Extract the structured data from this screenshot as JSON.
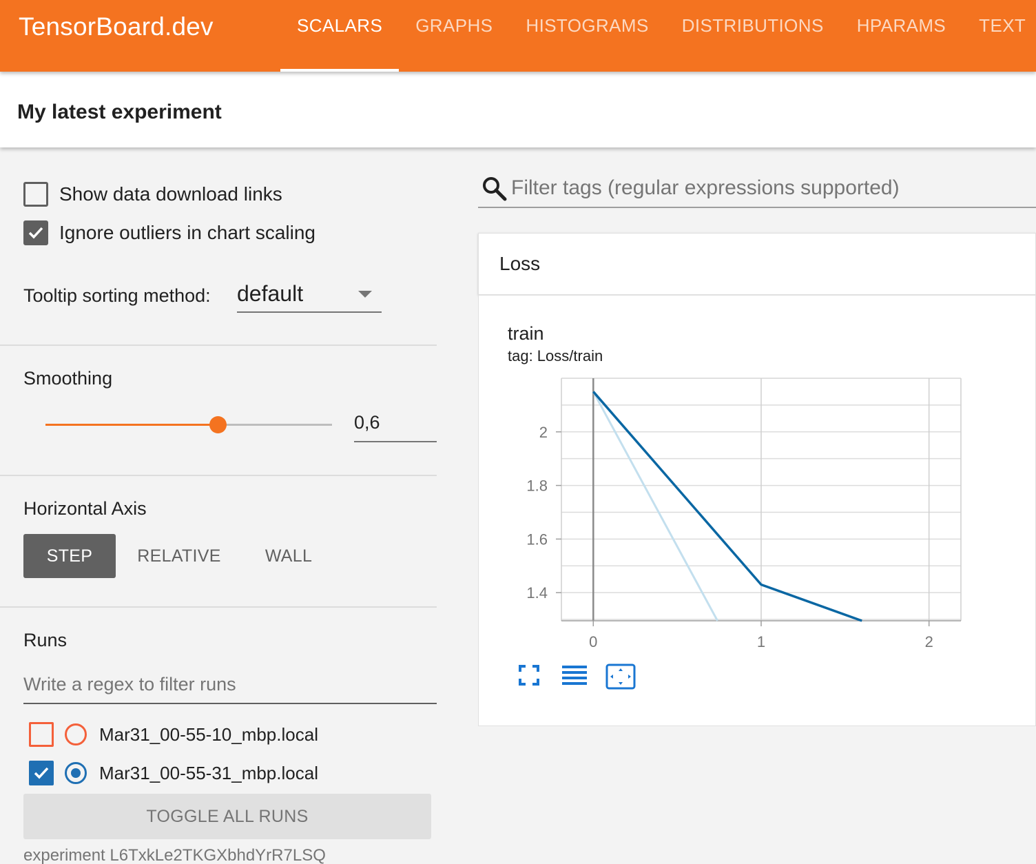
{
  "app": {
    "brand": "TensorBoard.dev",
    "tabs": [
      {
        "label": "SCALARS",
        "active": true
      },
      {
        "label": "GRAPHS",
        "active": false
      },
      {
        "label": "HISTOGRAMS",
        "active": false
      },
      {
        "label": "DISTRIBUTIONS",
        "active": false
      },
      {
        "label": "HPARAMS",
        "active": false
      },
      {
        "label": "TEXT",
        "active": false
      }
    ]
  },
  "experiment": {
    "title": "My latest experiment",
    "id_text": "experiment L6TxkLe2TKGXbhdYrR7LSQ"
  },
  "sidebar": {
    "show_download_links": {
      "label": "Show data download links",
      "checked": false
    },
    "ignore_outliers": {
      "label": "Ignore outliers in chart scaling",
      "checked": true
    },
    "tooltip_sorting": {
      "label": "Tooltip sorting method:",
      "value": "default"
    },
    "smoothing": {
      "title": "Smoothing",
      "value": 0.6,
      "display": "0,6"
    },
    "horizontal_axis": {
      "title": "Horizontal Axis",
      "options": [
        {
          "label": "STEP",
          "active": true
        },
        {
          "label": "RELATIVE",
          "active": false
        },
        {
          "label": "WALL",
          "active": false
        }
      ]
    },
    "runs": {
      "title": "Runs",
      "filter_placeholder": "Write a regex to filter runs",
      "items": [
        {
          "name": "Mar31_00-55-10_mbp.local",
          "checked": false,
          "selected": false,
          "color": "#f4603a"
        },
        {
          "name": "Mar31_00-55-31_mbp.local",
          "checked": true,
          "selected": true,
          "color": "#1f6fb3"
        }
      ],
      "toggle_all_label": "TOGGLE ALL RUNS"
    }
  },
  "main": {
    "tag_filter_placeholder": "Filter tags (regular expressions supported)",
    "card": {
      "title": "Loss",
      "chart_title": "train",
      "chart_tag": "tag: Loss/train"
    }
  },
  "chart_data": {
    "type": "line",
    "title": "train",
    "subtitle": "tag: Loss/train",
    "xlabel": "",
    "ylabel": "",
    "x_ticks": [
      0,
      1,
      2
    ],
    "y_ticks": [
      1.4,
      1.6,
      1.8,
      2
    ],
    "xlim": [
      -0.19,
      2.19
    ],
    "ylim": [
      1.295,
      2.2
    ],
    "grid": true,
    "series": [
      {
        "role": "smoothed",
        "color": "#0a67a3",
        "x": [
          0,
          1,
          1.6
        ],
        "y": [
          2.15,
          1.43,
          1.295
        ]
      },
      {
        "role": "raw",
        "color": "#c3dfee",
        "x": [
          0,
          0.74
        ],
        "y": [
          2.15,
          1.295
        ]
      }
    ]
  },
  "icons": {
    "search": "search-icon",
    "fullscreen": "fullscreen-icon",
    "log_scale": "lines-icon",
    "fit_domain": "fit-domain-icon"
  },
  "colors": {
    "brand": "#f47320",
    "chart_line": "#0a67a3",
    "chart_line_raw": "#c3dfee",
    "accent_blue": "#1976d2"
  }
}
